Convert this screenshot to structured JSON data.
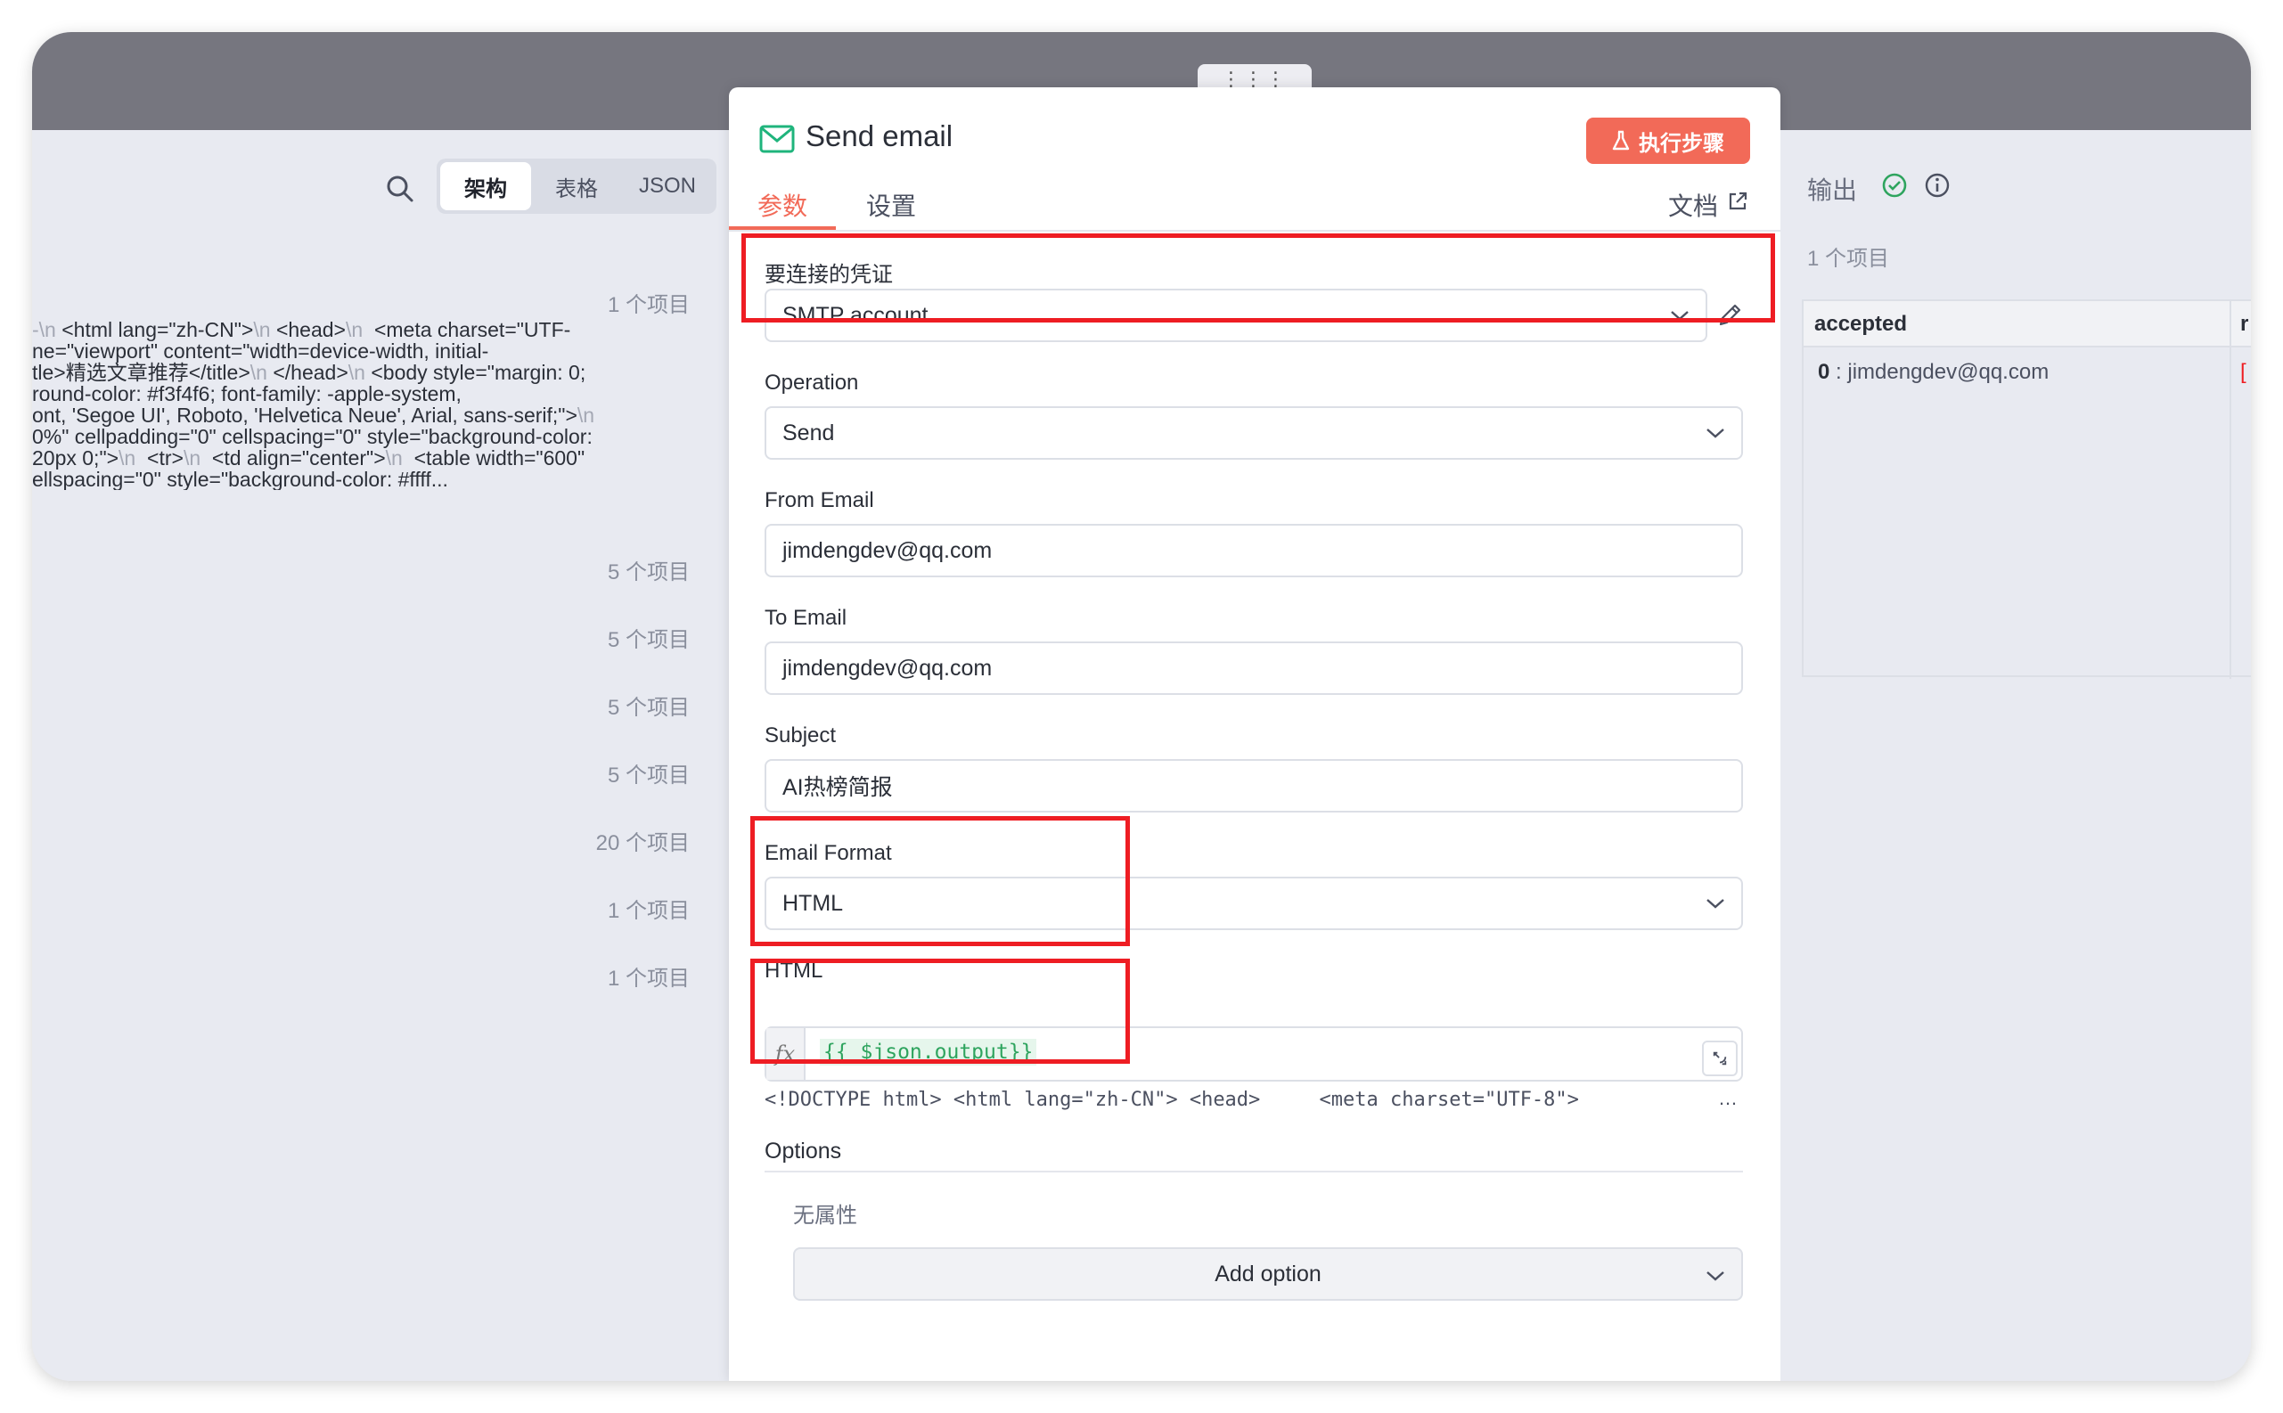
{
  "left_panel": {
    "view_modes": [
      "架构",
      "表格",
      "JSON"
    ],
    "active_view": "架构",
    "html_preview_lines": [
      [
        {
          "e": "-\\n "
        },
        {
          "t": "<html lang=\"zh-CN\">"
        },
        {
          "e": "\\n "
        },
        {
          "t": "<head>"
        },
        {
          "e": "\\n  "
        },
        {
          "t": "<meta charset=\"UTF-"
        }
      ],
      [
        {
          "t": "ne=\"viewport\" content=\"width=device-width, initial-"
        }
      ],
      [
        {
          "t": "tle>精选文章推荐</title>"
        },
        {
          "e": "\\n "
        },
        {
          "t": "</head>"
        },
        {
          "e": "\\n "
        },
        {
          "t": "<body style=\"margin: 0;"
        }
      ],
      [
        {
          "t": "round-color: #f3f4f6; font-family: -apple-system,"
        }
      ],
      [
        {
          "t": "ont, 'Segoe UI', Roboto, 'Helvetica Neue', Arial, sans-serif;\">"
        },
        {
          "e": "\\n"
        }
      ],
      [
        {
          "t": "0%\" cellpadding=\"0\" cellspacing=\"0\" style=\"background-color:"
        }
      ],
      [
        {
          "t": "20px 0;\">"
        },
        {
          "e": "\\n  "
        },
        {
          "t": "<tr>"
        },
        {
          "e": "\\n  "
        },
        {
          "t": "<td align=\"center\">"
        },
        {
          "e": "\\n  "
        },
        {
          "t": "<table width=\"600\""
        }
      ],
      [
        {
          "t": "ellspacing=\"0\" style=\"background-color: #ffff..."
        }
      ]
    ],
    "counts": [
      "1 个项目",
      "5 个项目",
      "5 个项目",
      "5 个项目",
      "5 个项目",
      "20 个项目",
      "1 个项目",
      "1 个项目"
    ]
  },
  "modal": {
    "title": "Send email",
    "execute_button": "执行步骤",
    "tabs": [
      "参数",
      "设置"
    ],
    "docs_link": "文档",
    "credential_label": "要连接的凭证",
    "credential_value": "SMTP account",
    "operation_label": "Operation",
    "operation_value": "Send",
    "from_label": "From Email",
    "from_value": "jimdengdev@qq.com",
    "to_label": "To Email",
    "to_value": "jimdengdev@qq.com",
    "subject_label": "Subject",
    "subject_value": "AI热榜简报",
    "format_label": "Email Format",
    "format_value": "HTML",
    "html_label": "HTML",
    "fx_label": "fx",
    "html_expression": "{{ $json.output}}",
    "html_preview": "<!DOCTYPE html> <html lang=\"zh-CN\"> <head>     <meta charset=\"UTF-8\">",
    "html_preview_ellipsis": "…",
    "options_label": "Options",
    "no_properties": "无属性",
    "add_option": "Add option"
  },
  "right_panel": {
    "title": "输出",
    "count": "1 个项目",
    "column": "accepted",
    "column2": "r",
    "row_index": "0",
    "row_sep": " : ",
    "row_value": "jimdengdev@qq.com",
    "row2_value": "["
  },
  "colors": {
    "accent": "#f26a58",
    "highlight_box": "#ee1d23",
    "success": "#2ea45e",
    "mail_icon": "#1fb47c"
  }
}
